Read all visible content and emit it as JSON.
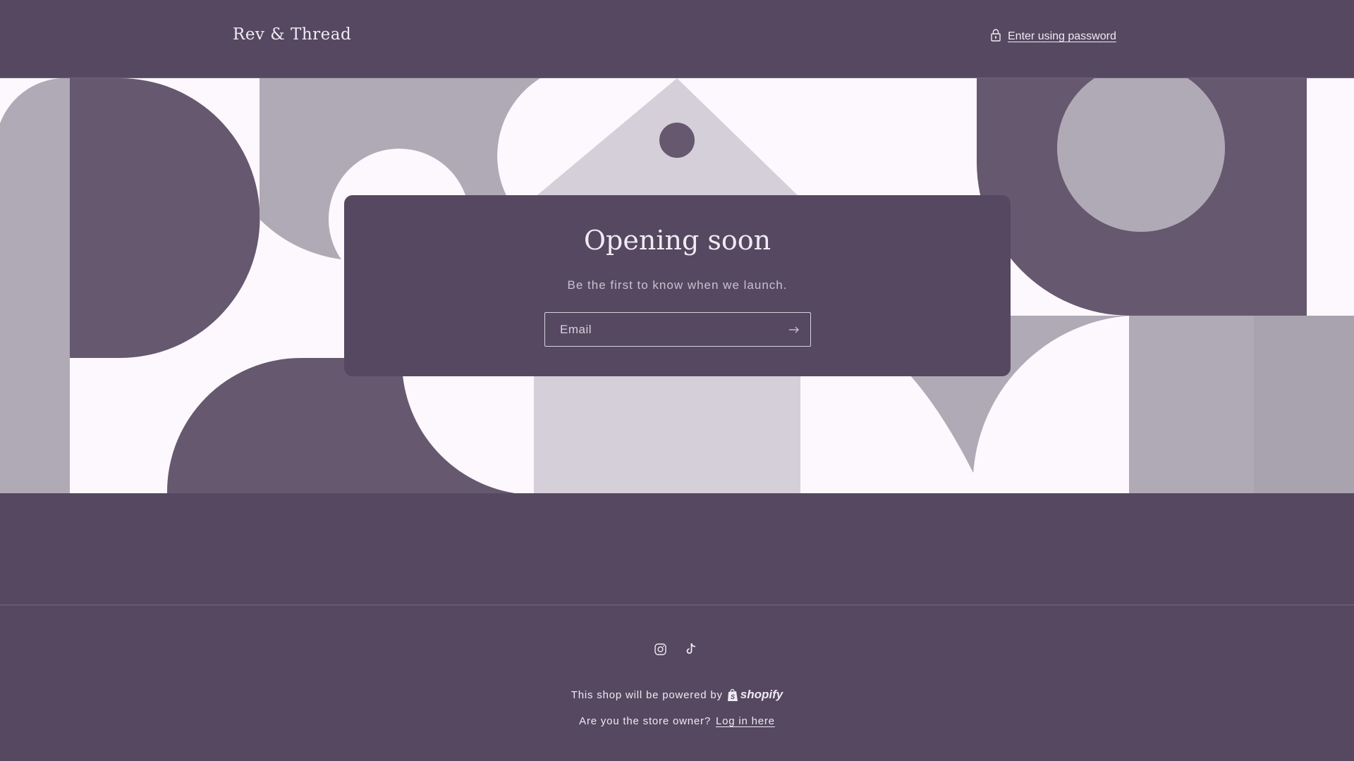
{
  "header": {
    "brand": "Rev & Thread",
    "password_link": "Enter using password",
    "lock_icon": "lock-icon"
  },
  "hero": {
    "title": "Opening soon",
    "subtitle": "Be the first to know when we launch.",
    "email_placeholder": "Email",
    "submit_icon": "arrow-right-icon"
  },
  "footer": {
    "socials": [
      "instagram-icon",
      "tiktok-icon"
    ],
    "powered_text": "This shop will be powered by",
    "powered_brand": "shopify",
    "owner_text": "Are you the store owner?",
    "login_link": "Log in here"
  },
  "colors": {
    "background": "#554860",
    "shape_dark": "#66586f",
    "shape_mid": "#b0aab6",
    "shape_light": "#d4cfd9",
    "shape_white": "#fcf8fd",
    "text": "#efeaf3"
  }
}
